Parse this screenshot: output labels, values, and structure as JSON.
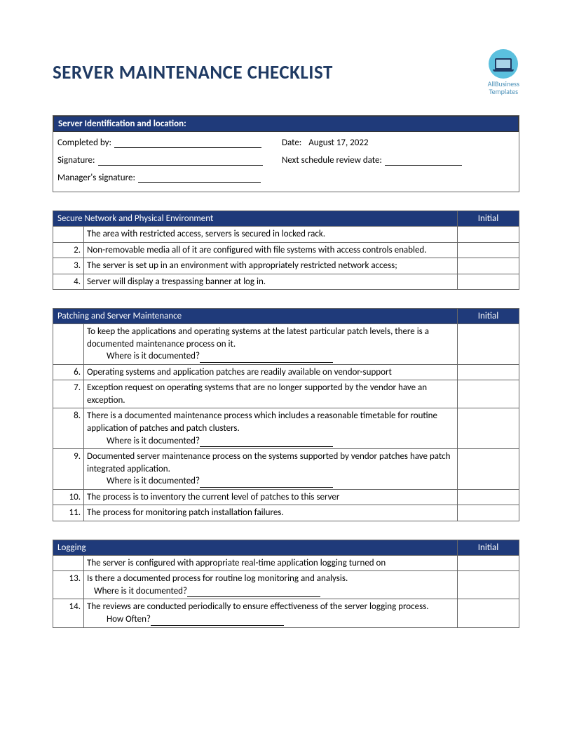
{
  "title": "SERVER MAINTENANCE CHECKLIST",
  "logo": {
    "line1": "AllBusiness",
    "line2": "Templates"
  },
  "info": {
    "header": "Server Identification and location:",
    "completed_by_label": "Completed by:",
    "date_label": "Date:",
    "date_value": "August 17, 2022",
    "signature_label": "Signature:",
    "next_review_label": "Next schedule review date:",
    "manager_sig_label": "Manager's signature:"
  },
  "sections": [
    {
      "title": "Secure Network and Physical Environment",
      "initial": "Initial",
      "rows": [
        {
          "num": "",
          "text": "The area with restricted access, servers is secured in locked rack."
        },
        {
          "num": "2.",
          "text": "Non-removable media all of it are configured with file systems with access controls enabled."
        },
        {
          "num": "3.",
          "text": "The server is set up in an environment with appropriately restricted network access;"
        },
        {
          "num": "4.",
          "text": "Server will display a trespassing banner at log in."
        }
      ]
    },
    {
      "title": "Patching and Server Maintenance",
      "initial": "Initial",
      "rows": [
        {
          "num": "",
          "text": "To keep the applications and operating systems at the latest particular patch levels, there is a documented maintenance process on it.",
          "sub": "Where is it documented?"
        },
        {
          "num": "6.",
          "text": "Operating systems and application patches are readily available on vendor-support"
        },
        {
          "num": "7.",
          "text": "Exception request on operating systems that are no longer supported by the vendor have an exception."
        },
        {
          "num": "8.",
          "text": "There is a documented maintenance process which includes a reasonable timetable for routine application of patches and patch clusters.",
          "sub": "Where is it documented?"
        },
        {
          "num": "9.",
          "text": "Documented server maintenance process on the systems supported by vendor patches have patch integrated application.",
          "sub": "Where is it documented?"
        },
        {
          "num": "10.",
          "text": "The process is to inventory the current level of patches to this server"
        },
        {
          "num": "11.",
          "text": "The process for monitoring patch installation failures."
        }
      ]
    },
    {
      "title": "Logging",
      "initial": "Initial",
      "rows": [
        {
          "num": "",
          "text": "The server is configured with appropriate real-time application logging turned on"
        },
        {
          "num": "13.",
          "text": "Is there a documented process for routine log monitoring and analysis.",
          "sub": "Where is it documented?",
          "subpad": "short"
        },
        {
          "num": "14.",
          "text": "The reviews are conducted periodically to ensure effectiveness of the server logging process.",
          "sub": "How Often?"
        }
      ]
    }
  ]
}
